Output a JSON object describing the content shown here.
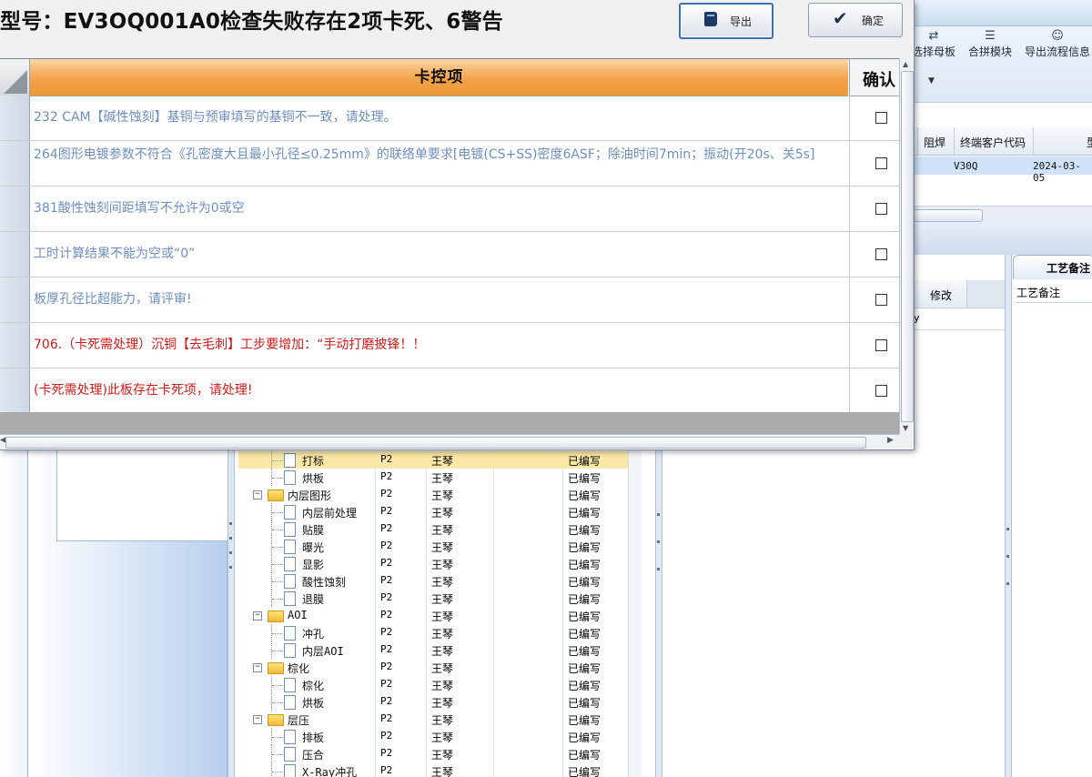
{
  "dialog": {
    "title": "型号：EV3OQ001A0检查失败存在2项卡死、6警告",
    "export_label": "导出",
    "ok_label": "确定",
    "columns": {
      "item": "卡控项",
      "confirm": "确认"
    },
    "rows": [
      {
        "text": "232 CAM【碱性蚀刻】基铜与预审填写的基铜不一致，请处理。",
        "severity": "warning",
        "checked": false
      },
      {
        "text": "264图形电镀参数不符合《孔密度大且最小孔径≤0.25mm》的联络单要求[电镀(CS+SS)密度6ASF；除油时间7min；振动(开20s、关5s]",
        "severity": "warning",
        "checked": false
      },
      {
        "text": "381酸性蚀刻间距填写不允许为0或空",
        "severity": "warning",
        "checked": false
      },
      {
        "text": "工时计算结果不能为空或“0”",
        "severity": "warning",
        "checked": false
      },
      {
        "text": "板厚孔径比超能力，请评审!",
        "severity": "warning",
        "checked": false
      },
      {
        "text": "706.（卡死需处理）沉铜【去毛刺】工步要增加：“手动打磨披锋！！",
        "severity": "fatal",
        "checked": false
      },
      {
        "text": "(卡死需处理)此板存在卡死项，请处理!",
        "severity": "fatal",
        "checked": false
      }
    ]
  },
  "colors": {
    "warning": "#6d8fbf",
    "fatal": "#d11a1a",
    "header_orange": "#f3a24a",
    "selection_blue": "#cfe2f8"
  },
  "toolbar": {
    "buttons": [
      {
        "label": "选择母板",
        "icon": "shuffle-icon"
      },
      {
        "label": "合拼模块",
        "icon": "list-icon"
      },
      {
        "label": "导出流程信息",
        "icon": "smile-icon"
      }
    ]
  },
  "order_grid": {
    "columns": [
      "阻焊",
      "终端客户代码",
      "型"
    ],
    "row": {
      "code": "V30Q",
      "date": "2024-03-05"
    }
  },
  "mid_panel": {
    "column": "修改",
    "row_text": "y"
  },
  "right_panel": {
    "tab": "工艺备注",
    "field": "工艺备注"
  },
  "process_tree": {
    "rows": [
      {
        "name": "打标",
        "level": 1,
        "code": "P2",
        "operator": "王琴",
        "status": "已编写",
        "selected": true
      },
      {
        "name": "烘板",
        "level": 1,
        "code": "P2",
        "operator": "王琴",
        "status": "已编写"
      },
      {
        "name": "内层图形",
        "level": 0,
        "code": "P2",
        "operator": "王琴",
        "status": "已编写"
      },
      {
        "name": "内层前处理",
        "level": 1,
        "code": "P2",
        "operator": "王琴",
        "status": "已编写"
      },
      {
        "name": "贴膜",
        "level": 1,
        "code": "P2",
        "operator": "王琴",
        "status": "已编写"
      },
      {
        "name": "曝光",
        "level": 1,
        "code": "P2",
        "operator": "王琴",
        "status": "已编写"
      },
      {
        "name": "显影",
        "level": 1,
        "code": "P2",
        "operator": "王琴",
        "status": "已编写"
      },
      {
        "name": "酸性蚀刻",
        "level": 1,
        "code": "P2",
        "operator": "王琴",
        "status": "已编写"
      },
      {
        "name": "退膜",
        "level": 1,
        "code": "P2",
        "operator": "王琴",
        "status": "已编写"
      },
      {
        "name": "AOI",
        "level": 0,
        "code": "P2",
        "operator": "王琴",
        "status": "已编写"
      },
      {
        "name": "冲孔",
        "level": 1,
        "code": "P2",
        "operator": "王琴",
        "status": "已编写"
      },
      {
        "name": "内层AOI",
        "level": 1,
        "code": "P2",
        "operator": "王琴",
        "status": "已编写"
      },
      {
        "name": "棕化",
        "level": 0,
        "code": "P2",
        "operator": "王琴",
        "status": "已编写"
      },
      {
        "name": "棕化",
        "level": 1,
        "code": "P2",
        "operator": "王琴",
        "status": "已编写"
      },
      {
        "name": "烘板",
        "level": 1,
        "code": "P2",
        "operator": "王琴",
        "status": "已编写"
      },
      {
        "name": "层压",
        "level": 0,
        "code": "P2",
        "operator": "王琴",
        "status": "已编写"
      },
      {
        "name": "排板",
        "level": 1,
        "code": "P2",
        "operator": "王琴",
        "status": "已编写"
      },
      {
        "name": "压合",
        "level": 1,
        "code": "P2",
        "operator": "王琴",
        "status": "已编写"
      },
      {
        "name": "X-Ray冲孔",
        "level": 1,
        "code": "P2",
        "operator": "王琴",
        "status": "已编写"
      }
    ]
  }
}
